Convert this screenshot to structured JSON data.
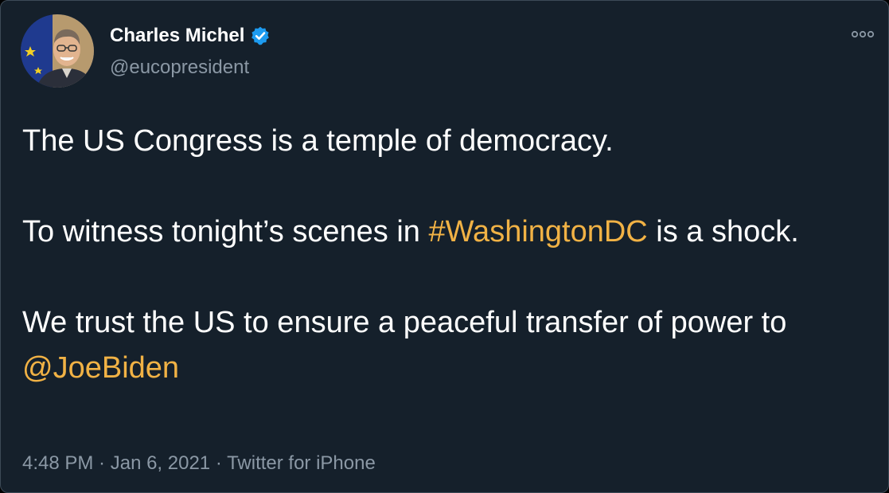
{
  "author": {
    "name": "Charles Michel",
    "handle": "@eucopresident",
    "verified": true,
    "avatar_icon": "profile-photo"
  },
  "more_icon": "more-options-icon",
  "tweet": {
    "line1": "The US Congress is a temple of democracy.",
    "line2_pre": "To witness tonight’s scenes in ",
    "line2_hashtag": "#WashingtonDC",
    "line2_post": " is a shock.",
    "line3_pre": "We trust the US to ensure a peaceful transfer of power to ",
    "line3_mention": "@JoeBiden"
  },
  "meta": {
    "time": "4:48 PM",
    "separator1": " · ",
    "date": "Jan 6, 2021",
    "separator2": " · ",
    "source": "Twitter for iPhone"
  },
  "colors": {
    "background": "#15202b",
    "link": "#f1b245",
    "secondary_text": "#8b98a5",
    "verified_badge": "#1d9bf0"
  }
}
